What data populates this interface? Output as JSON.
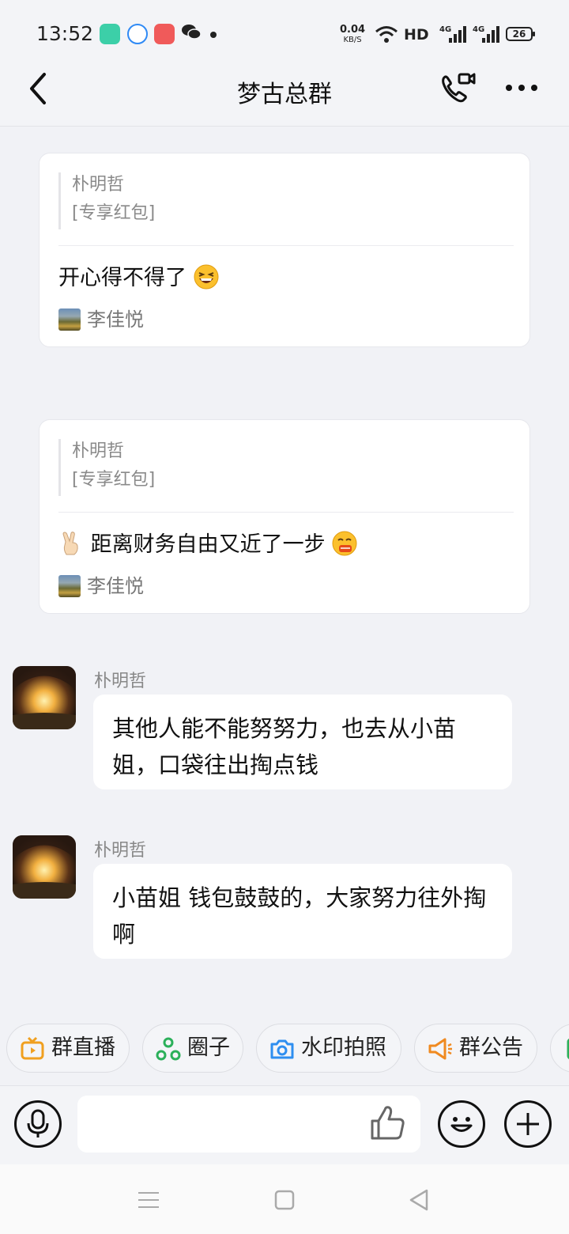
{
  "status_bar": {
    "time": "13:52",
    "net_speed_value": "0.04",
    "net_speed_unit": "KB/S",
    "hd_label": "HD",
    "battery": "26"
  },
  "header": {
    "title": "梦古总群"
  },
  "cards": [
    {
      "quote_sender": "朴明哲",
      "quote_text": "[专享红包]",
      "message": "开心得不得了",
      "author": "李佳悦"
    },
    {
      "quote_sender": "朴明哲",
      "quote_text": "[专享红包]",
      "message": "距离财务自由又近了一步",
      "author": "李佳悦"
    }
  ],
  "messages": [
    {
      "sender": "朴明哲",
      "text": "其他人能不能努努力，也去从小苗姐，口袋往出掏点钱"
    },
    {
      "sender": "朴明哲",
      "text": "小苗姐  钱包鼓鼓的，大家努力往外掏啊"
    }
  ],
  "quick_actions": [
    {
      "label": "群直播",
      "icon": "tv-icon",
      "color": "#f0a020"
    },
    {
      "label": "圈子",
      "icon": "circle-nodes-icon",
      "color": "#2bb05a"
    },
    {
      "label": "水印拍照",
      "icon": "camera-icon",
      "color": "#2e8ef0"
    },
    {
      "label": "群公告",
      "icon": "megaphone-icon",
      "color": "#f08a20"
    }
  ],
  "input": {
    "placeholder": ""
  }
}
